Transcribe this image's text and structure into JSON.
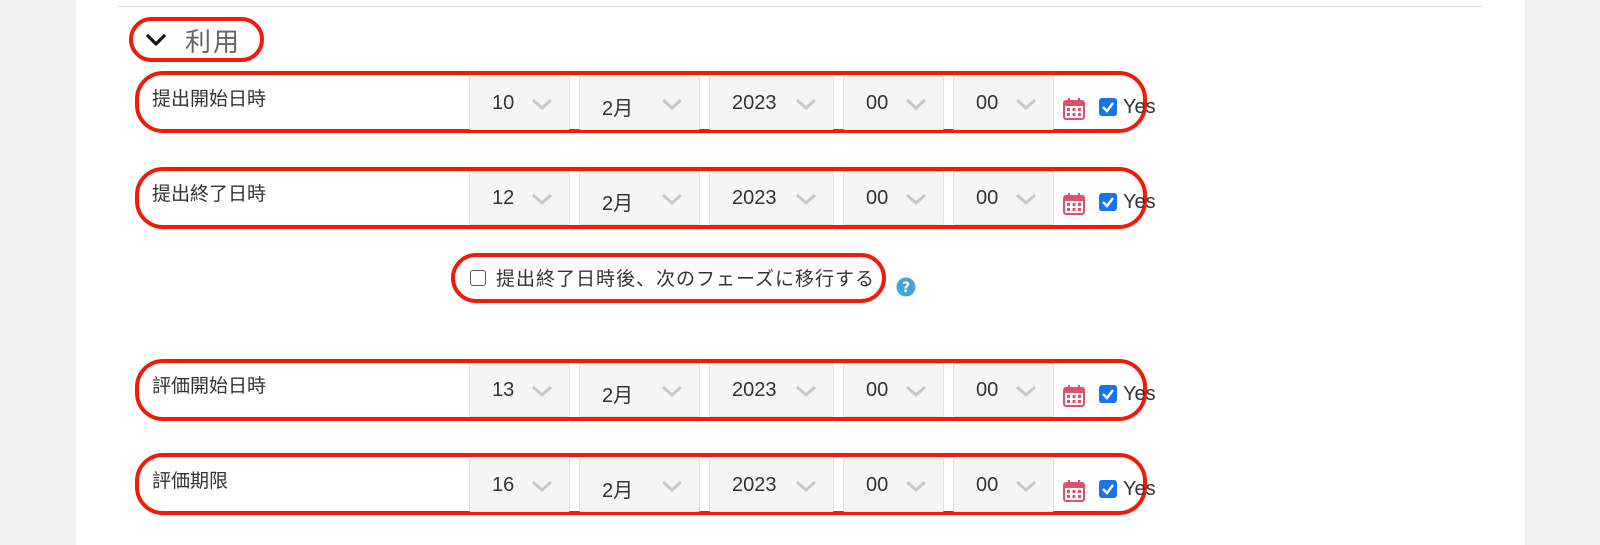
{
  "section": {
    "title": "利用",
    "icon": "chevron-down-icon"
  },
  "rows": [
    {
      "label": "提出開始日時",
      "day": "10",
      "month": "2月",
      "year": "2023",
      "hour": "00",
      "minute": "00",
      "enabled_label": "Yes"
    },
    {
      "label": "提出終了日時",
      "day": "12",
      "month": "2月",
      "year": "2023",
      "hour": "00",
      "minute": "00",
      "enabled_label": "Yes"
    },
    {
      "label": "評価開始日時",
      "day": "13",
      "month": "2月",
      "year": "2023",
      "hour": "00",
      "minute": "00",
      "enabled_label": "Yes"
    },
    {
      "label": "評価期限",
      "day": "16",
      "month": "2月",
      "year": "2023",
      "hour": "00",
      "minute": "00",
      "enabled_label": "Yes"
    }
  ],
  "phase_switch": {
    "label": "提出終了日時後、次のフェーズに移行する",
    "checked": false,
    "help_icon": "question-circle-icon"
  },
  "colors": {
    "highlight_ring": "#ee1c0a",
    "checkbox_blue": "#1a73e8",
    "calendar_pink": "#e0506e",
    "help_blue": "#3fa7d8"
  }
}
